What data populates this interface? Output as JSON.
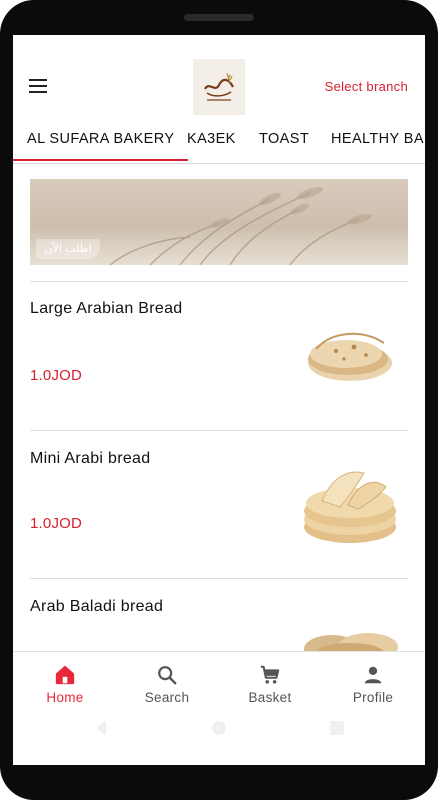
{
  "header": {
    "logo_alt": "Al Sufara Bakery logo",
    "select_branch_label": "Select branch"
  },
  "tabs": [
    {
      "label": "AL SUFARA BAKERY",
      "active": true
    },
    {
      "label": "KA3EK",
      "active": false
    },
    {
      "label": "TOAST",
      "active": false
    },
    {
      "label": "HEALTHY BAK",
      "active": false
    }
  ],
  "banner": {
    "badge_text": "اطلب الآن"
  },
  "products": [
    {
      "name": "Large Arabian Bread",
      "price": "1.0JOD",
      "image": "large-arabian-bread"
    },
    {
      "name": "Mini Arabi bread",
      "price": "1.0JOD",
      "image": "mini-arabi-bread"
    },
    {
      "name": "Arab Baladi bread",
      "price": "",
      "image": "arab-baladi-bread"
    }
  ],
  "bottom_nav": [
    {
      "label": "Home",
      "icon": "home-icon",
      "active": true
    },
    {
      "label": "Search",
      "icon": "search-icon",
      "active": false
    },
    {
      "label": "Basket",
      "icon": "cart-icon",
      "active": false
    },
    {
      "label": "Profile",
      "icon": "person-icon",
      "active": false
    }
  ],
  "colors": {
    "accent": "#d8202f",
    "active_nav": "#e8283a",
    "text": "#111111",
    "muted": "#555555"
  }
}
